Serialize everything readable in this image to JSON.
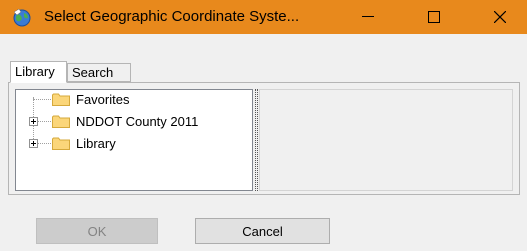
{
  "window": {
    "title": "Select Geographic Coordinate Syste...",
    "accent": "#e8891c"
  },
  "tabs": [
    {
      "label": "Library",
      "active": true
    },
    {
      "label": "Search",
      "active": false
    }
  ],
  "tree": {
    "items": [
      {
        "label": "Favorites",
        "expandable": false,
        "icon": "folder-icon"
      },
      {
        "label": "NDDOT County 2011",
        "expandable": true,
        "icon": "folder-icon"
      },
      {
        "label": "Library",
        "expandable": true,
        "icon": "folder-icon"
      }
    ]
  },
  "buttons": {
    "ok_label": "OK",
    "cancel_label": "Cancel"
  },
  "icons": {
    "app": "globe-icon",
    "minimize": "minimize-icon",
    "maximize": "maximize-icon",
    "close": "close-icon"
  }
}
